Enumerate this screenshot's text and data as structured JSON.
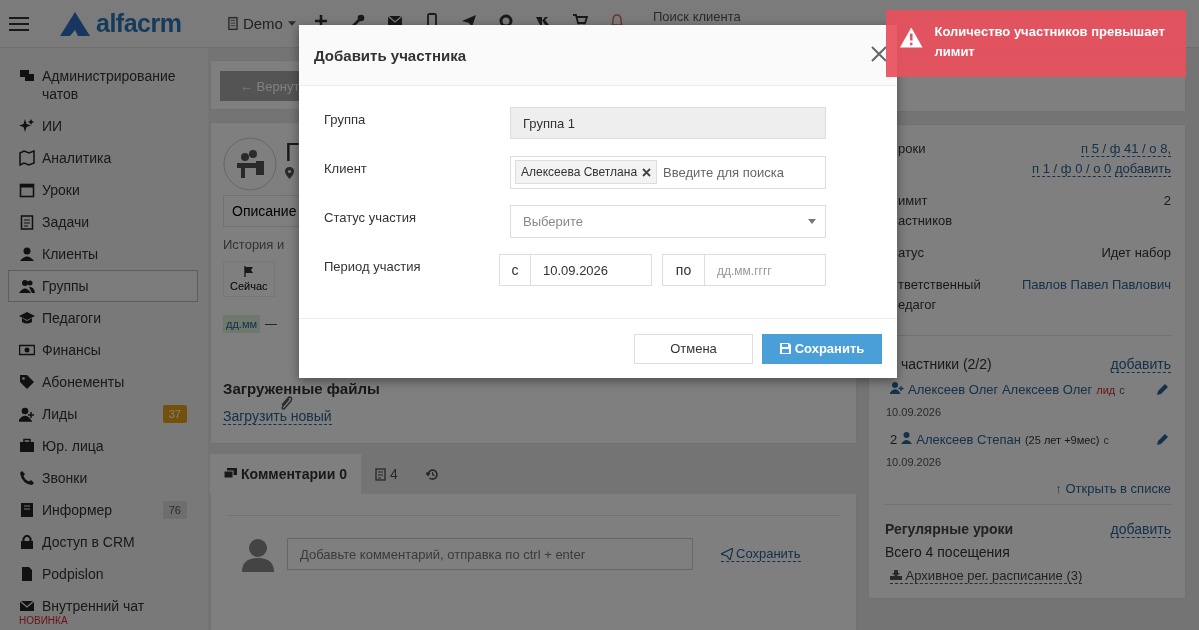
{
  "topbar": {
    "logo": "alfacrm",
    "branch": "Demo",
    "search_placeholder": "Поиск клиента"
  },
  "sidebar": {
    "items": [
      {
        "label": "Администрирование чатов",
        "selected": false
      },
      {
        "label": "ИИ",
        "selected": false
      },
      {
        "label": "Аналитика",
        "selected": false
      },
      {
        "label": "Уроки",
        "selected": false
      },
      {
        "label": "Задачи",
        "selected": false
      },
      {
        "label": "Клиенты",
        "selected": false
      },
      {
        "label": "Группы",
        "selected": true
      },
      {
        "label": "Педагоги",
        "selected": false
      },
      {
        "label": "Финансы",
        "selected": false
      },
      {
        "label": "Абонементы",
        "selected": false
      },
      {
        "label": "Лиды",
        "selected": false,
        "badge": "37",
        "color": "#74510b"
      },
      {
        "label": "Юр. лица",
        "selected": false
      },
      {
        "label": "Звонки",
        "selected": false
      },
      {
        "label": "Информер",
        "selected": false,
        "badge": "76",
        "color": "#6e6e6e"
      },
      {
        "label": "Доступ в CRM",
        "selected": false
      },
      {
        "label": "Podpislon",
        "selected": false
      },
      {
        "label": "Внутренний чат",
        "selected": false,
        "tag": "НОВИНКА"
      }
    ]
  },
  "back_button": "← Вернут",
  "group_card": {
    "title": "Г",
    "description_tab": "Описание",
    "history_label": "История и",
    "now_button": "Сейчас",
    "date_badge": "дд.мм",
    "date_note": "—",
    "files_title": "Загруженные файлы",
    "upload_link": "Загрузить новый"
  },
  "tabs": [
    {
      "kind": "comments",
      "label": "Комментарии 0",
      "selected": true
    },
    {
      "kind": "tasks",
      "label": "4",
      "selected": false
    },
    {
      "kind": "history",
      "selected": false
    }
  ],
  "comment": {
    "placeholder": "Добавьте комментарий, отправка по ctrl + enter",
    "save": "Сохранить"
  },
  "info": [
    {
      "label_lines": [
        "роки"
      ],
      "links": [
        "п 5 / ф 41 / о 8,",
        "п 1 / ф 0 / о 0",
        "добавить"
      ]
    },
    {
      "label_lines": [
        "имит",
        "астников"
      ],
      "value": "2"
    },
    {
      "label_lines": [
        "атус"
      ],
      "value": "Идет набор"
    },
    {
      "label_lines": [
        "тветственный",
        "едагог"
      ],
      "links": [
        "Павлов Павел Павлович"
      ]
    }
  ],
  "participants": {
    "title": "частники (2/2)",
    "add": "добавить",
    "members": [
      {
        "kind": "lead",
        "name": "Алексеев Олег Алексеев Олег",
        "tag": "лид",
        "since": "с",
        "date": "10.09.2026"
      },
      {
        "kind": "client",
        "number": "2",
        "name": "Алексеев Степан",
        "age": "(25 лет +9мес)",
        "since": "с",
        "date": "10.09.2026"
      }
    ],
    "open_list": "↑ Открыть в списке"
  },
  "regular": {
    "title": "Регулярные уроки",
    "add": "добавить",
    "total": "Всего 4 посещения",
    "archive": "Архивное рег. расписание (3)"
  },
  "modal": {
    "title": "Добавить участника",
    "fields": [
      {
        "kind": "readonly",
        "label": "Группа",
        "value": "Группа 1"
      },
      {
        "kind": "tags",
        "label": "Клиент",
        "tags": [
          "Алексеева Светлана"
        ],
        "placeholder": "Введите для поиска"
      },
      {
        "kind": "select",
        "label": "Статус участия",
        "placeholder": "Выберите"
      },
      {
        "kind": "period",
        "label": "Период участия",
        "from_label": "с",
        "from_value": "10.09.2026",
        "to_label": "по",
        "to_placeholder": "дд.мм.гггг"
      }
    ],
    "cancel": "Отмена",
    "save": "Сохранить"
  },
  "toast": {
    "message": "Количество участников превышает лимит"
  }
}
